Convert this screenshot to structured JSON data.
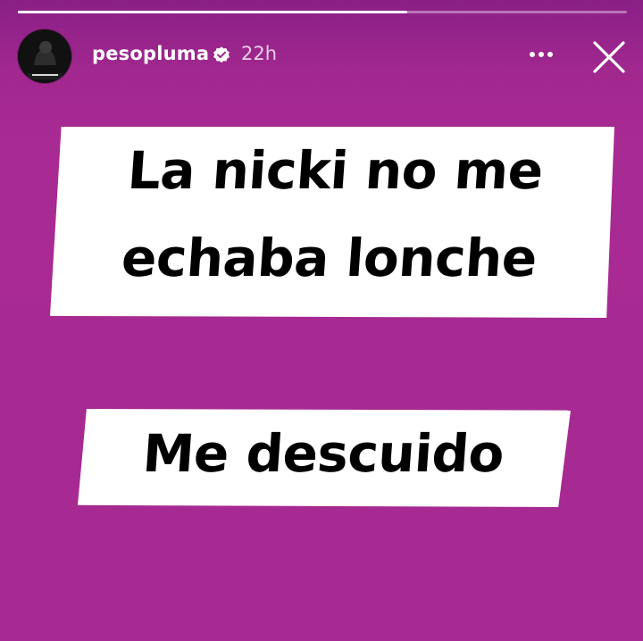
{
  "story": {
    "progress": 0.64,
    "background_color": "#a82a93"
  },
  "header": {
    "avatar_icon": "avatar-icon",
    "username": "pesopluma",
    "verified_icon": "verified-badge-icon",
    "time_ago": "22h",
    "more_icon": "more-dots-icon",
    "close_icon": "close-icon"
  },
  "captions": {
    "block_1": {
      "line_1": "La nicki no me",
      "line_2": "echaba lonche"
    },
    "block_2": {
      "line_1": "Me descuido"
    }
  }
}
